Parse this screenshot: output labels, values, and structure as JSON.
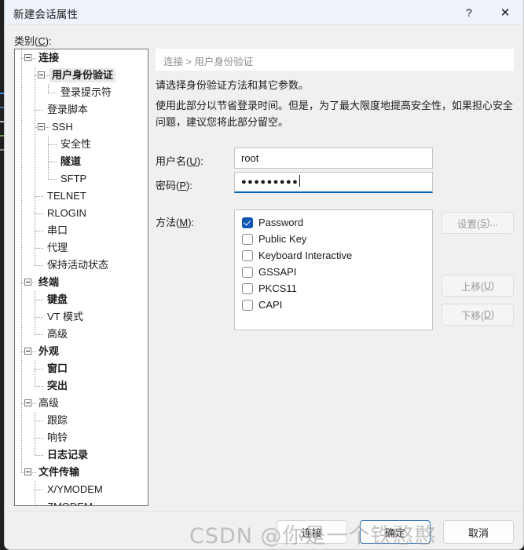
{
  "window": {
    "title": "新建会话属性",
    "help_label": "?",
    "close_label": "✕"
  },
  "category": {
    "label_prefix": "类别(",
    "label_mnemonic": "C",
    "label_suffix": "):"
  },
  "tree": {
    "items": [
      {
        "label": "连接",
        "depth": 0,
        "bold": true,
        "expander": true,
        "selected": false
      },
      {
        "label": "用户身份验证",
        "depth": 1,
        "bold": true,
        "expander": true,
        "selected": true
      },
      {
        "label": "登录提示符",
        "depth": 2,
        "bold": false,
        "expander": false,
        "selected": false
      },
      {
        "label": "登录脚本",
        "depth": 1,
        "bold": false,
        "expander": false,
        "selected": false
      },
      {
        "label": "SSH",
        "depth": 1,
        "bold": false,
        "expander": true,
        "selected": false
      },
      {
        "label": "安全性",
        "depth": 2,
        "bold": false,
        "expander": false,
        "selected": false
      },
      {
        "label": "隧道",
        "depth": 2,
        "bold": true,
        "expander": false,
        "selected": false
      },
      {
        "label": "SFTP",
        "depth": 2,
        "bold": false,
        "expander": false,
        "selected": false
      },
      {
        "label": "TELNET",
        "depth": 1,
        "bold": false,
        "expander": false,
        "selected": false
      },
      {
        "label": "RLOGIN",
        "depth": 1,
        "bold": false,
        "expander": false,
        "selected": false
      },
      {
        "label": "串口",
        "depth": 1,
        "bold": false,
        "expander": false,
        "selected": false
      },
      {
        "label": "代理",
        "depth": 1,
        "bold": false,
        "expander": false,
        "selected": false
      },
      {
        "label": "保持活动状态",
        "depth": 1,
        "bold": false,
        "expander": false,
        "selected": false
      },
      {
        "label": "终端",
        "depth": 0,
        "bold": true,
        "expander": true,
        "selected": false
      },
      {
        "label": "键盘",
        "depth": 1,
        "bold": true,
        "expander": false,
        "selected": false
      },
      {
        "label": "VT 模式",
        "depth": 1,
        "bold": false,
        "expander": false,
        "selected": false
      },
      {
        "label": "高级",
        "depth": 1,
        "bold": false,
        "expander": false,
        "selected": false
      },
      {
        "label": "外观",
        "depth": 0,
        "bold": true,
        "expander": true,
        "selected": false
      },
      {
        "label": "窗口",
        "depth": 1,
        "bold": true,
        "expander": false,
        "selected": false
      },
      {
        "label": "突出",
        "depth": 1,
        "bold": true,
        "expander": false,
        "selected": false
      },
      {
        "label": "高级",
        "depth": 0,
        "bold": false,
        "expander": true,
        "selected": false
      },
      {
        "label": "跟踪",
        "depth": 1,
        "bold": false,
        "expander": false,
        "selected": false
      },
      {
        "label": "响铃",
        "depth": 1,
        "bold": false,
        "expander": false,
        "selected": false
      },
      {
        "label": "日志记录",
        "depth": 1,
        "bold": true,
        "expander": false,
        "selected": false
      },
      {
        "label": "文件传输",
        "depth": 0,
        "bold": true,
        "expander": true,
        "selected": false
      },
      {
        "label": "X/YMODEM",
        "depth": 1,
        "bold": false,
        "expander": false,
        "selected": false
      },
      {
        "label": "ZMODEM",
        "depth": 1,
        "bold": false,
        "expander": false,
        "selected": false
      }
    ]
  },
  "pane": {
    "breadcrumb": "连接 > 用户身份验证",
    "description_1": "请选择身份验证方法和其它参数。",
    "description_2": "使用此部分以节省登录时间。但是，为了最大限度地提高安全性，如果担心安全问题，建议您将此部分留空。"
  },
  "form": {
    "username_label_prefix": "用户名(",
    "username_label_mnemonic": "U",
    "username_label_suffix": "):",
    "username_value": "root",
    "username_placeholder": "",
    "password_label_prefix": "密码(",
    "password_label_mnemonic": "P",
    "password_label_suffix": "):",
    "password_masked": "●●●●●●●●●",
    "password_placeholder": "",
    "method_label_prefix": "方法(",
    "method_label_mnemonic": "M",
    "method_label_suffix": "):",
    "methods": [
      {
        "label": "Password",
        "checked": true
      },
      {
        "label": "Public Key",
        "checked": false
      },
      {
        "label": "Keyboard Interactive",
        "checked": false
      },
      {
        "label": "GSSAPI",
        "checked": false
      },
      {
        "label": "PKCS11",
        "checked": false
      },
      {
        "label": "CAPI",
        "checked": false
      }
    ]
  },
  "side_buttons": [
    {
      "prefix": "设置(",
      "mnemonic": "S",
      "suffix": ")...",
      "enabled": false
    },
    {
      "prefix": "上移(",
      "mnemonic": "U",
      "suffix": ")",
      "enabled": false
    },
    {
      "prefix": "下移(",
      "mnemonic": "D",
      "suffix": ")",
      "enabled": false
    }
  ],
  "footer": {
    "connect_label": "连接",
    "ok_label": "确定",
    "cancel_label": "取消"
  },
  "watermark": {
    "text": "CSDN @你是一个铁憨憨"
  },
  "colors": {
    "accent": "#0067c0",
    "checkbox_checked": "#0f57b3",
    "dialog_bg": "#f0f0f0",
    "titlebar_bg": "#eef3fb",
    "panel_bg": "#ffffff",
    "default_button_border": "#2f6fba"
  }
}
